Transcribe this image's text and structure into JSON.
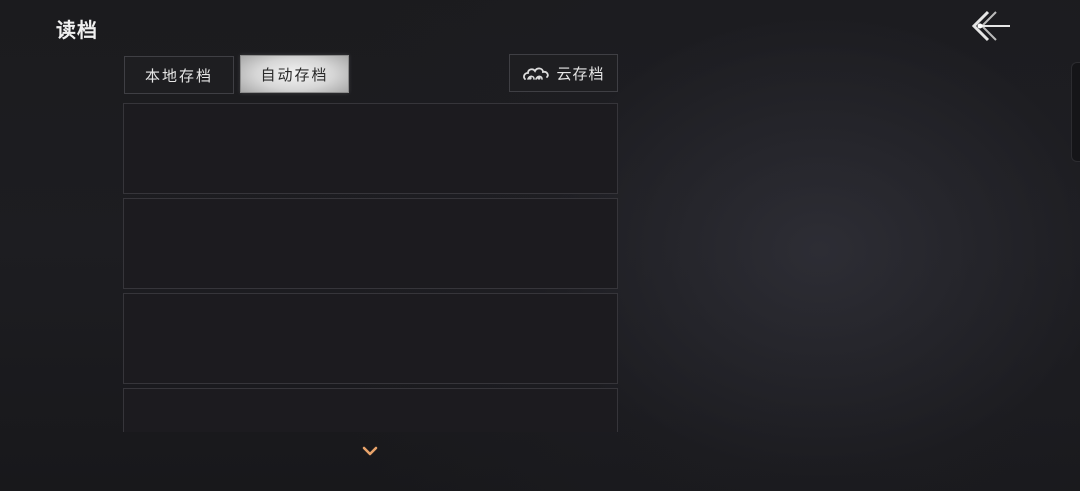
{
  "header": {
    "title": "读档",
    "back_icon": "back-arrow-icon"
  },
  "tabs": [
    {
      "label": "本地存档",
      "selected": false
    },
    {
      "label": "自动存档",
      "selected": true
    },
    {
      "label": "云存档",
      "icon": "cloud-icon",
      "selected": false
    }
  ],
  "slots": [
    {
      "index": 1,
      "label": ""
    },
    {
      "index": 2,
      "label": ""
    },
    {
      "index": 3,
      "label": ""
    },
    {
      "index": 4,
      "label": ""
    }
  ],
  "scroll": {
    "icon": "chevron-down-icon",
    "color": "#e8a36a"
  },
  "colors": {
    "selected_tab": "#d6d6d6",
    "tab_text": "#e6e6e6",
    "slot_bg": "#1c1b1f",
    "accent": "#e8a36a"
  }
}
